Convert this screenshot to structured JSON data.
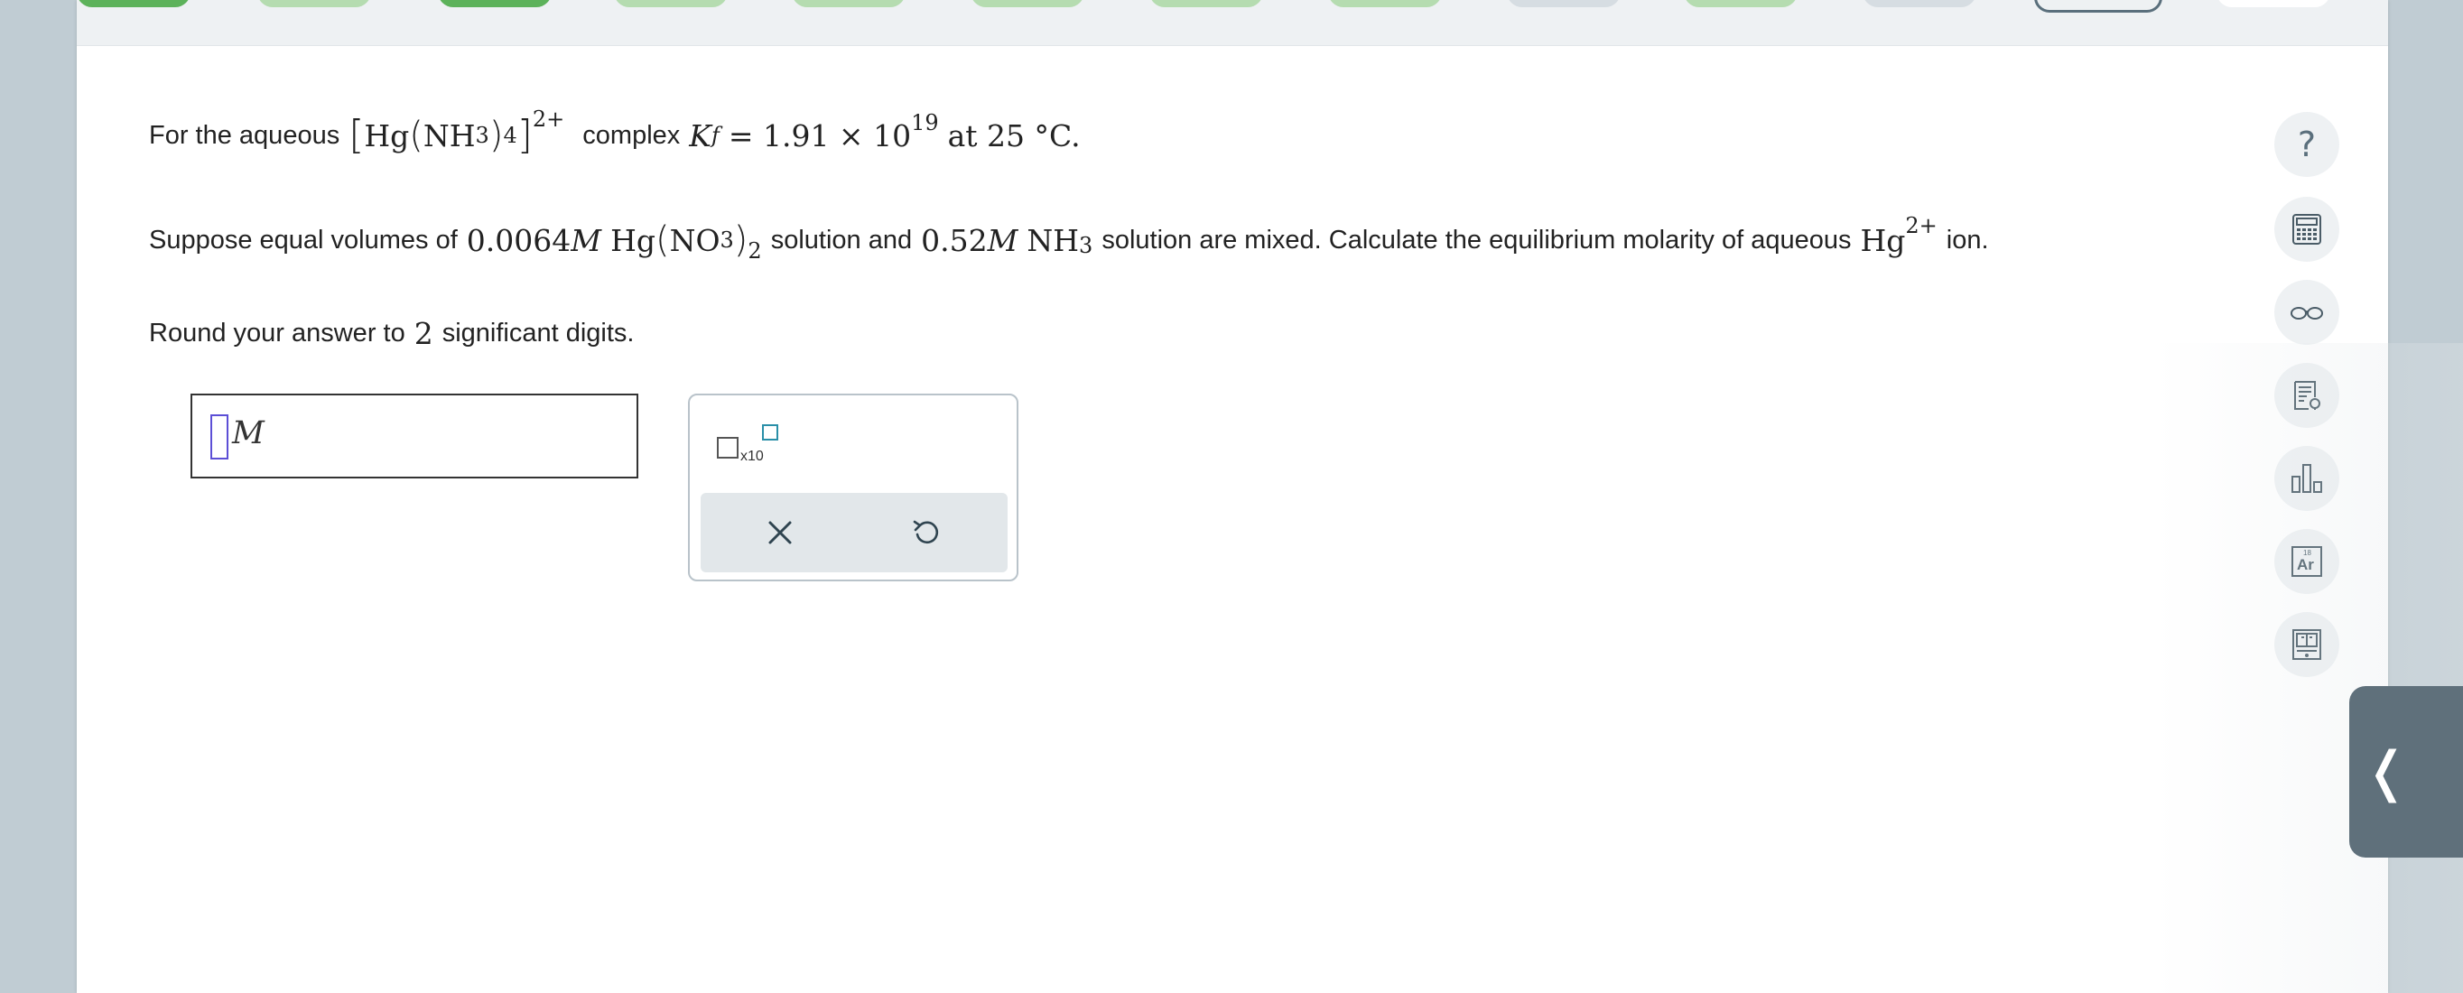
{
  "question": {
    "line1": {
      "prefix": "For the aqueous",
      "complex_metal": "Hg",
      "ligand": "NH",
      "ligand_sub": "3",
      "count": "4",
      "charge": "2+",
      "word_complex": "complex",
      "K": "K",
      "K_sub": "f",
      "equals": "= 1.91 × 10",
      "exponent": "19",
      "suffix": "at 25 °C."
    },
    "line2": {
      "prefix": "Suppose equal volumes of",
      "conc1": "0.0064",
      "M": "M",
      "salt_metal": "Hg",
      "salt_anion": "NO",
      "salt_anion_sub": "3",
      "salt_count": "2",
      "mid1": "solution and",
      "conc2": "0.52",
      "base": "NH",
      "base_sub": "3",
      "mid2": "solution are mixed. Calculate the equilibrium molarity of aqueous",
      "ion": "Hg",
      "ion_charge": "2+",
      "suffix": "ion."
    },
    "line3": {
      "prefix": "Round your answer to",
      "digits": "2",
      "suffix": "significant digits."
    }
  },
  "answer": {
    "value": "",
    "unit": "M"
  },
  "palette": {
    "x10_label": "x10",
    "clear_icon": "close-icon",
    "undo_icon": "undo-icon"
  },
  "tools": [
    "help-icon",
    "calculator-icon",
    "reading-glasses-icon",
    "notes-icon",
    "bar-chart-icon",
    "periodic-table-icon",
    "reference-book-icon"
  ],
  "tool_help_symbol": "?",
  "tool_periodic_symbol": "Ar",
  "tool_periodic_number": "18",
  "drawer_toggle": "❬",
  "colors": {
    "progress_done": "#b5dcb0",
    "progress_current": "#5cb25a",
    "cursor": "#5c4fd6",
    "drawer": "#5f707b"
  }
}
